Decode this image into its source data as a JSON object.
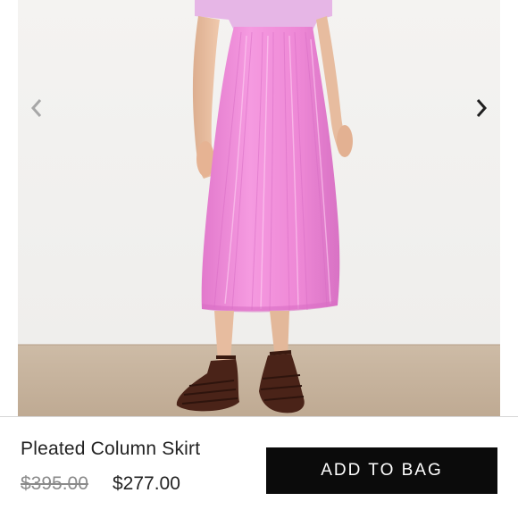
{
  "product": {
    "name": "Pleated Column Skirt",
    "original_price": "$395.00",
    "sale_price": "$277.00"
  },
  "actions": {
    "add_to_bag_label": "ADD TO BAG"
  },
  "gallery": {
    "prev_icon": "chevron-left-icon",
    "next_icon": "chevron-right-icon"
  },
  "colors": {
    "skirt": "#f08ad8",
    "button_bg": "#0b0b0b",
    "button_text": "#ffffff",
    "old_price": "#8a8a8a"
  }
}
